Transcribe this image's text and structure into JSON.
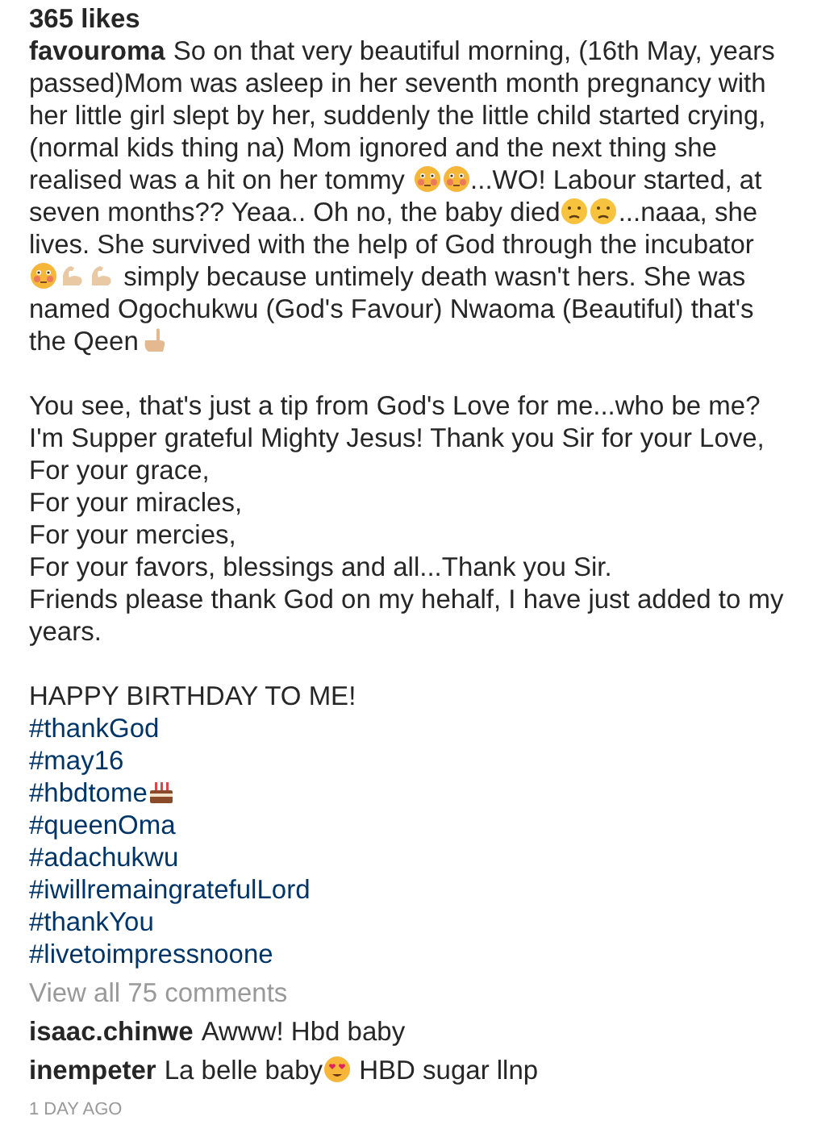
{
  "likes": "365 likes",
  "caption": {
    "username": "favouroma",
    "groups": [
      [
        [
          {
            "kind": "text",
            "text": "So on that very beautiful morning, (16th May, years passed)Mom was asleep in her seventh month pregnancy with her little girl slept by her, suddenly the little child started crying, (normal kids thing na) Mom ignored and the next thing she realised was a hit on her tommy "
          },
          {
            "kind": "flushed"
          },
          {
            "kind": "flushed"
          },
          {
            "kind": "text",
            "text": "...WO! Labour started, at seven months?? Yeaa.. Oh no, the baby died"
          },
          {
            "kind": "confused"
          },
          {
            "kind": "confused"
          },
          {
            "kind": "text",
            "text": "...naaa, she lives. She survived with the help of God through the incubator "
          },
          {
            "kind": "flushed"
          },
          {
            "kind": "muscle"
          },
          {
            "kind": "muscle"
          },
          {
            "kind": "text",
            "text": " simply because untimely death wasn't hers. She was named Ogochukwu (God's Favour) Nwaoma (Beautiful) that's the Qeen"
          },
          {
            "kind": "pointing"
          }
        ]
      ],
      [
        [
          {
            "kind": "text",
            "text": "You see, that's just a tip from God's Love for me...who be me? I'm Supper grateful Mighty Jesus! Thank you Sir for your Love,"
          }
        ],
        [
          {
            "kind": "text",
            "text": "For your grace,"
          }
        ],
        [
          {
            "kind": "text",
            "text": "For your miracles,"
          }
        ],
        [
          {
            "kind": "text",
            "text": "For your mercies,"
          }
        ],
        [
          {
            "kind": "text",
            "text": "For your favors, blessings and all...Thank you Sir."
          }
        ],
        [
          {
            "kind": "text",
            "text": "Friends please thank God on my hehalf, I have just added to my years."
          }
        ]
      ],
      [
        [
          {
            "kind": "text",
            "text": "HAPPY BIRTHDAY TO ME!"
          }
        ],
        [
          {
            "kind": "hashtag",
            "text": "#thankGod"
          }
        ],
        [
          {
            "kind": "hashtag",
            "text": "#may16"
          }
        ],
        [
          {
            "kind": "hashtag",
            "text": "#hbdtome"
          },
          {
            "kind": "cake"
          }
        ],
        [
          {
            "kind": "hashtag",
            "text": "#queenOma"
          }
        ],
        [
          {
            "kind": "hashtag",
            "text": "#adachukwu"
          }
        ],
        [
          {
            "kind": "hashtag",
            "text": "#iwillremaingratefulLord"
          }
        ],
        [
          {
            "kind": "hashtag",
            "text": "#thankYou"
          }
        ],
        [
          {
            "kind": "hashtag",
            "text": "#livetoimpressnoone"
          }
        ]
      ]
    ]
  },
  "view_all": "View all 75 comments",
  "comments": [
    {
      "username": "isaac.chinwe",
      "parts": [
        {
          "kind": "text",
          "text": "Awww! Hbd baby"
        }
      ]
    },
    {
      "username": "inempeter",
      "parts": [
        {
          "kind": "text",
          "text": "La belle baby"
        },
        {
          "kind": "hearteyes"
        },
        {
          "kind": "text",
          "text": " HBD sugar llnp"
        }
      ]
    }
  ],
  "time": "1 DAY AGO"
}
